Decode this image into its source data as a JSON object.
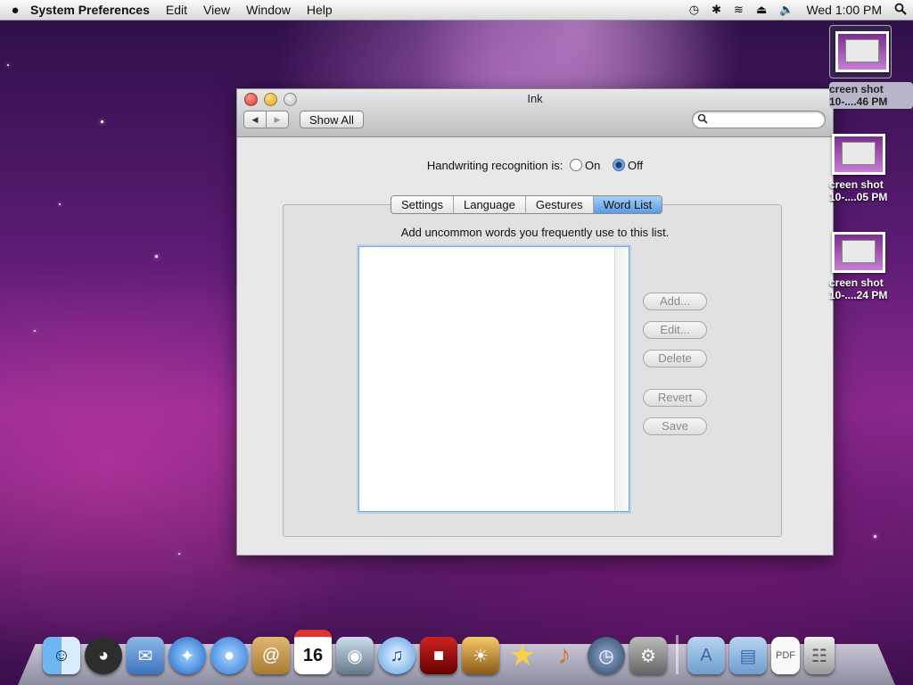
{
  "menubar": {
    "app_name": "System Preferences",
    "menus": [
      "Edit",
      "View",
      "Window",
      "Help"
    ],
    "clock": "Wed 1:00 PM",
    "icons": [
      "time-machine-icon",
      "bluetooth-icon",
      "wifi-icon",
      "eject-icon",
      "volume-icon",
      "spotlight-icon"
    ]
  },
  "window": {
    "title": "Ink",
    "show_all": "Show All",
    "search_placeholder": ""
  },
  "handwriting": {
    "label": "Handwriting recognition is:",
    "on_label": "On",
    "off_label": "Off",
    "selected": "Off"
  },
  "tabs": [
    "Settings",
    "Language",
    "Gestures",
    "Word List"
  ],
  "active_tab": "Word List",
  "word_list": {
    "caption": "Add uncommon words you frequently use to this list.",
    "items": []
  },
  "buttons": {
    "add": "Add...",
    "edit": "Edit...",
    "delete": "Delete",
    "revert": "Revert",
    "save": "Save"
  },
  "desktop": [
    {
      "line1": "creen shot",
      "line2": "10-....46 PM"
    },
    {
      "line1": "creen shot",
      "line2": "10-....05 PM"
    },
    {
      "line1": "creen shot",
      "line2": "10-....24 PM"
    }
  ],
  "dock": {
    "calendar_day": "16",
    "items": [
      "finder-icon",
      "dashboard-icon",
      "mail-icon",
      "safari-icon",
      "ichat-icon",
      "address-book-icon",
      "ical-icon",
      "preview-icon",
      "itunes-icon",
      "front-row-icon",
      "iphoto-icon",
      "imovie-icon",
      "garageband-icon",
      "time-machine-icon",
      "system-preferences-icon",
      "applications-folder-icon",
      "documents-folder-icon",
      "pdf-document-icon",
      "trash-icon"
    ]
  }
}
